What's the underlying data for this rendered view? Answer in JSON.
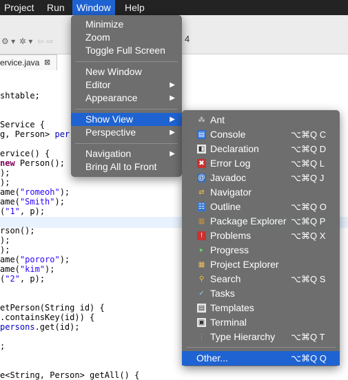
{
  "menubar": {
    "items": [
      {
        "label": "Project"
      },
      {
        "label": "Run"
      },
      {
        "label": "Window"
      },
      {
        "label": "Help"
      }
    ]
  },
  "toolbar": {
    "title_fragment": "4"
  },
  "editor_tab": {
    "label": "ervice.java",
    "close": "⊠"
  },
  "code_lines": [
    {
      "segments": [
        {
          "t": "shtable;",
          "c": ""
        }
      ]
    },
    {
      "segments": [
        {
          "t": "",
          "c": ""
        }
      ]
    },
    {
      "segments": [
        {
          "t": "Service {",
          "c": ""
        }
      ]
    },
    {
      "segments": [
        {
          "t": "g, Person> ",
          "c": ""
        },
        {
          "t": "per",
          "c": "fld"
        }
      ]
    },
    {
      "segments": [
        {
          "t": "",
          "c": ""
        }
      ]
    },
    {
      "segments": [
        {
          "t": "ervice() {",
          "c": ""
        }
      ]
    },
    {
      "segments": [
        {
          "t": "new",
          "c": "kw"
        },
        {
          "t": " Person();",
          "c": ""
        }
      ]
    },
    {
      "segments": [
        {
          "t": ");",
          "c": ""
        }
      ]
    },
    {
      "segments": [
        {
          "t": ");",
          "c": ""
        }
      ]
    },
    {
      "segments": [
        {
          "t": "ame(",
          "c": ""
        },
        {
          "t": "\"romeoh\"",
          "c": "str"
        },
        {
          "t": ");",
          "c": ""
        }
      ]
    },
    {
      "segments": [
        {
          "t": "ame(",
          "c": ""
        },
        {
          "t": "\"Smith\"",
          "c": "str"
        },
        {
          "t": ");",
          "c": ""
        }
      ]
    },
    {
      "segments": [
        {
          "t": "(",
          "c": ""
        },
        {
          "t": "\"1\"",
          "c": "str"
        },
        {
          "t": ", p);",
          "c": ""
        }
      ]
    },
    {
      "segments": [
        {
          "t": "",
          "c": ""
        }
      ]
    },
    {
      "segments": [
        {
          "t": "rson();",
          "c": ""
        }
      ]
    },
    {
      "segments": [
        {
          "t": ");",
          "c": ""
        }
      ]
    },
    {
      "segments": [
        {
          "t": ");",
          "c": ""
        }
      ]
    },
    {
      "segments": [
        {
          "t": "ame(",
          "c": ""
        },
        {
          "t": "\"pororo\"",
          "c": "str"
        },
        {
          "t": ");",
          "c": ""
        }
      ]
    },
    {
      "segments": [
        {
          "t": "ame(",
          "c": ""
        },
        {
          "t": "\"kim\"",
          "c": "str"
        },
        {
          "t": ");",
          "c": ""
        }
      ]
    },
    {
      "segments": [
        {
          "t": "(",
          "c": ""
        },
        {
          "t": "\"2\"",
          "c": "str"
        },
        {
          "t": ", p);",
          "c": ""
        }
      ]
    },
    {
      "segments": [
        {
          "t": "",
          "c": ""
        }
      ]
    },
    {
      "segments": [
        {
          "t": "",
          "c": ""
        }
      ]
    },
    {
      "segments": [
        {
          "t": "etPerson(String id) {",
          "c": ""
        }
      ]
    },
    {
      "segments": [
        {
          "t": ".containsKey(id)) {",
          "c": ""
        }
      ]
    },
    {
      "segments": [
        {
          "t": "persons",
          "c": "fld"
        },
        {
          "t": ".get(id);",
          "c": ""
        }
      ]
    },
    {
      "segments": [
        {
          "t": "",
          "c": ""
        }
      ]
    },
    {
      "segments": [
        {
          "t": ";",
          "c": ""
        }
      ]
    },
    {
      "segments": [
        {
          "t": "",
          "c": ""
        }
      ]
    },
    {
      "segments": [
        {
          "t": "",
          "c": ""
        }
      ]
    },
    {
      "segments": [
        {
          "t": "e<String, Person> getAll() {",
          "c": ""
        }
      ]
    }
  ],
  "window_menu": {
    "items": [
      {
        "label": "Minimize",
        "submenu": false
      },
      {
        "label": "Zoom",
        "submenu": false
      },
      {
        "label": "Toggle Full Screen",
        "submenu": false
      },
      {
        "label": "New Window",
        "submenu": false
      },
      {
        "label": "Editor",
        "submenu": true
      },
      {
        "label": "Appearance",
        "submenu": true
      },
      {
        "label": "Show View",
        "submenu": true
      },
      {
        "label": "Perspective",
        "submenu": true
      },
      {
        "label": "Navigation",
        "submenu": true
      },
      {
        "label": "Bring All to Front",
        "submenu": false
      }
    ],
    "arrow": "▶"
  },
  "show_view_menu": {
    "items": [
      {
        "label": "Ant",
        "shortcut": "",
        "icon": "ant-icon"
      },
      {
        "label": "Console",
        "shortcut": "⌥⌘Q C",
        "icon": "console-icon"
      },
      {
        "label": "Declaration",
        "shortcut": "⌥⌘Q D",
        "icon": "declaration-icon"
      },
      {
        "label": "Error Log",
        "shortcut": "⌥⌘Q L",
        "icon": "error-log-icon"
      },
      {
        "label": "Javadoc",
        "shortcut": "⌥⌘Q J",
        "icon": "javadoc-icon"
      },
      {
        "label": "Navigator",
        "shortcut": "",
        "icon": "navigator-icon"
      },
      {
        "label": "Outline",
        "shortcut": "⌥⌘Q O",
        "icon": "outline-icon"
      },
      {
        "label": "Package Explorer",
        "shortcut": "⌥⌘Q P",
        "icon": "package-explorer-icon"
      },
      {
        "label": "Problems",
        "shortcut": "⌥⌘Q X",
        "icon": "problems-icon"
      },
      {
        "label": "Progress",
        "shortcut": "",
        "icon": "progress-icon"
      },
      {
        "label": "Project Explorer",
        "shortcut": "",
        "icon": "project-explorer-icon"
      },
      {
        "label": "Search",
        "shortcut": "⌥⌘Q S",
        "icon": "search-icon"
      },
      {
        "label": "Tasks",
        "shortcut": "",
        "icon": "tasks-icon"
      },
      {
        "label": "Templates",
        "shortcut": "",
        "icon": "templates-icon"
      },
      {
        "label": "Terminal",
        "shortcut": "",
        "icon": "terminal-icon"
      },
      {
        "label": "Type Hierarchy",
        "shortcut": "⌥⌘Q T",
        "icon": "type-hierarchy-icon"
      }
    ],
    "other": {
      "label": "Other...",
      "shortcut": "⌥⌘Q Q"
    }
  },
  "colors": {
    "menu_highlight": "#1f63d2",
    "menubar_bg": "#232323",
    "menu_bg": "#686868"
  }
}
